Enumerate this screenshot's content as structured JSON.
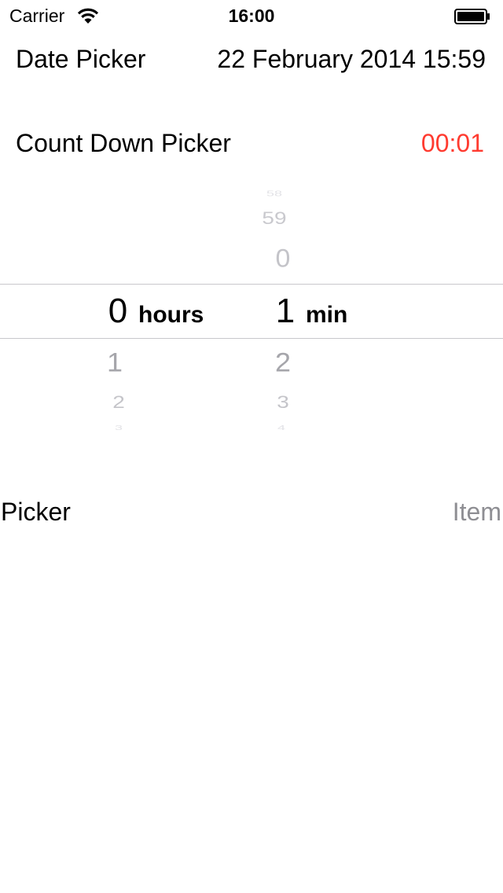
{
  "status_bar": {
    "carrier": "Carrier",
    "time": "16:00",
    "wifi_icon": "wifi-icon",
    "battery_icon": "battery-icon"
  },
  "date_picker": {
    "label": "Date Picker",
    "value": "22 February 2014 15:59"
  },
  "countdown_picker": {
    "label": "Count Down Picker",
    "value": "00:01",
    "value_color": "#ff3b30",
    "hours": {
      "selected": "0",
      "unit": "hours",
      "below": [
        "1",
        "2",
        "3"
      ]
    },
    "minutes": {
      "above": [
        "58",
        "59",
        "0"
      ],
      "selected": "1",
      "unit": "min",
      "below": [
        "2",
        "3",
        "4"
      ]
    }
  },
  "picker": {
    "label": "Picker",
    "value": "Item",
    "value_color": "#8e8e93"
  }
}
